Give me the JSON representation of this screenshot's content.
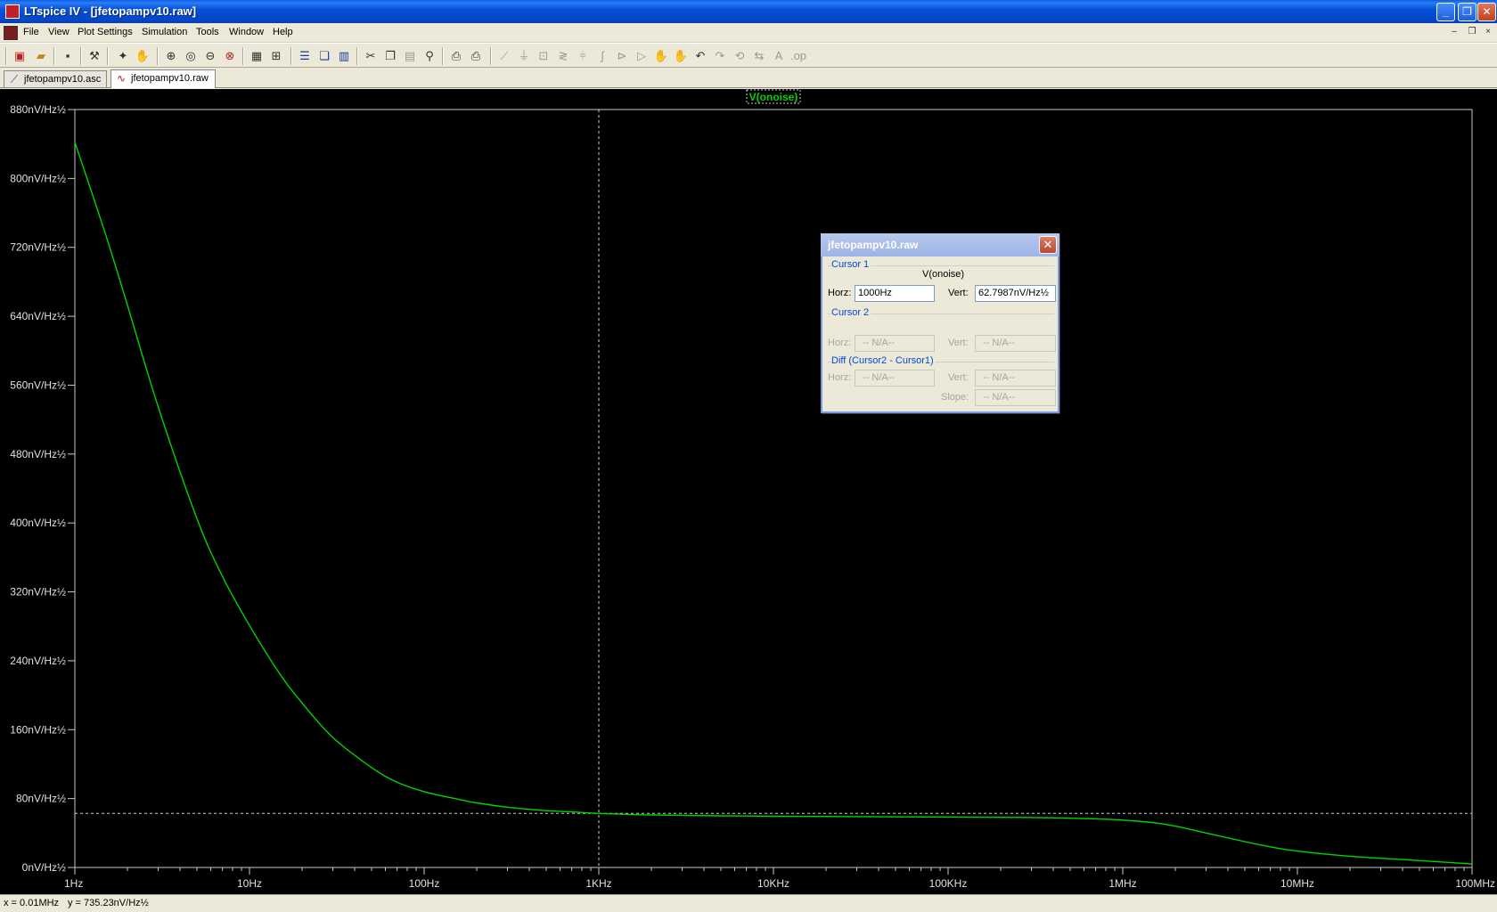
{
  "window": {
    "title": "LTspice IV - [jfetopampv10.raw]",
    "min": "_",
    "max": "❐",
    "close": "✕"
  },
  "menu": {
    "items": [
      "File",
      "View",
      "Plot Settings",
      "Simulation",
      "Tools",
      "Window",
      "Help"
    ],
    "mdi_min": "–",
    "mdi_restore": "❐",
    "mdi_close": "×"
  },
  "tabs": [
    {
      "label": "jfetopampv10.asc",
      "icon": "schematic-icon"
    },
    {
      "label": "jfetopampv10.raw",
      "icon": "waveform-icon"
    }
  ],
  "colors": {
    "trace": "#00d400",
    "background": "#000000",
    "axis": "#c8c8c8",
    "cursor": "#d0d0d0"
  },
  "chart_data": {
    "type": "line",
    "title": "V(onoise)",
    "xscale": "log",
    "xlim": [
      1,
      100000000
    ],
    "ylim": [
      0,
      880
    ],
    "x_ticks": [
      {
        "label": "1Hz",
        "v": 1
      },
      {
        "label": "10Hz",
        "v": 10
      },
      {
        "label": "100Hz",
        "v": 100
      },
      {
        "label": "1KHz",
        "v": 1000
      },
      {
        "label": "10KHz",
        "v": 10000
      },
      {
        "label": "100KHz",
        "v": 100000
      },
      {
        "label": "1MHz",
        "v": 1000000
      },
      {
        "label": "10MHz",
        "v": 10000000
      },
      {
        "label": "100MHz",
        "v": 100000000
      }
    ],
    "y_ticks": [
      {
        "label": "0nV/Hz½",
        "v": 0
      },
      {
        "label": "80nV/Hz½",
        "v": 80
      },
      {
        "label": "160nV/Hz½",
        "v": 160
      },
      {
        "label": "240nV/Hz½",
        "v": 240
      },
      {
        "label": "320nV/Hz½",
        "v": 320
      },
      {
        "label": "400nV/Hz½",
        "v": 400
      },
      {
        "label": "480nV/Hz½",
        "v": 480
      },
      {
        "label": "560nV/Hz½",
        "v": 560
      },
      {
        "label": "640nV/Hz½",
        "v": 640
      },
      {
        "label": "720nV/Hz½",
        "v": 720
      },
      {
        "label": "800nV/Hz½",
        "v": 800
      },
      {
        "label": "880nV/Hz½",
        "v": 880
      }
    ],
    "series": [
      {
        "name": "V(onoise)",
        "x": [
          1,
          1.5,
          2,
          3,
          5,
          7,
          10,
          15,
          20,
          30,
          50,
          70,
          100,
          150,
          200,
          300,
          500,
          700,
          1000,
          2000,
          5000,
          10000,
          30000,
          100000,
          300000,
          700000,
          1000000,
          1500000,
          2000000,
          3000000,
          5000000,
          7000000,
          10000000,
          20000000,
          50000000,
          100000000
        ],
        "y": [
          842,
          735,
          653,
          535,
          405,
          338,
          281,
          224,
          191,
          151,
          116,
          99,
          88,
          80,
          75,
          70,
          66,
          64.5,
          62.8,
          61,
          60,
          59.5,
          59,
          58.5,
          58,
          56.5,
          55,
          52,
          48,
          40,
          30,
          24,
          19,
          13,
          8,
          4
        ]
      }
    ],
    "cursor": {
      "x": 1000,
      "y": 62.7987
    },
    "grid": false,
    "legend": "top-center"
  },
  "cursor_dialog": {
    "title": "jfetopampv10.raw",
    "close": "✕",
    "cursor1_label": "Cursor 1",
    "trace_name": "V(onoise)",
    "horz_label": "Horz:",
    "horz_value": "1000Hz",
    "vert_label": "Vert:",
    "vert_value": "62.7987nV/Hz½",
    "cursor2_label": "Cursor 2",
    "c2_horz_label": "Horz:",
    "c2_horz_value": "-- N/A--",
    "c2_vert_label": "Vert:",
    "c2_vert_value": "-- N/A--",
    "diff_label": "Diff (Cursor2 - Cursor1)",
    "diff_horz_label": "Horz:",
    "diff_horz_value": "-- N/A--",
    "diff_vert_label": "Vert:",
    "diff_vert_value": "-- N/A--",
    "slope_label": "Slope:",
    "slope_value": "-- N/A--"
  },
  "status": {
    "x": "x = 0.01MHz",
    "y": "y = 735.23nV/Hz½"
  }
}
